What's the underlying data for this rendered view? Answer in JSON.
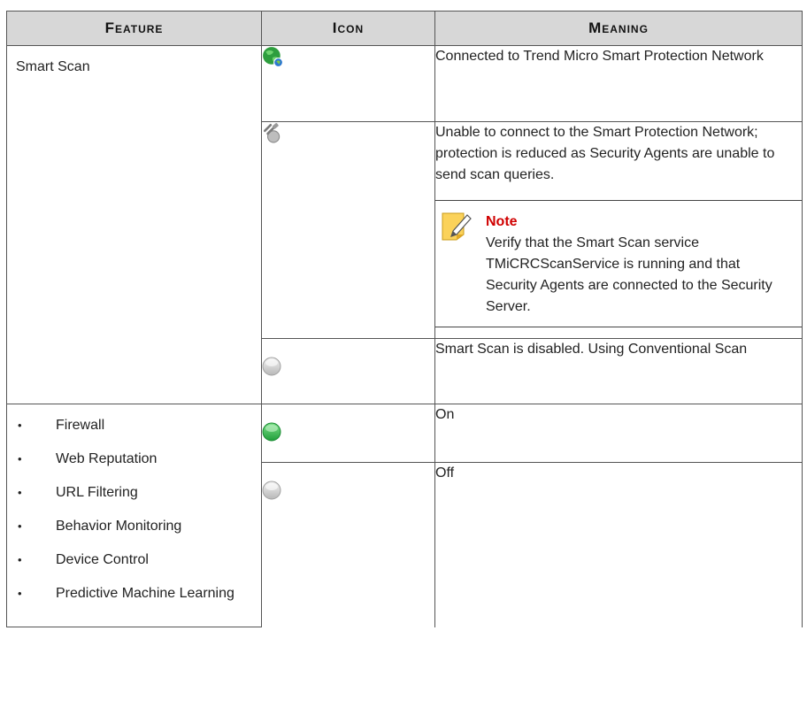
{
  "headers": {
    "feature": "Feature",
    "icon": "Icon",
    "meaning": "Meaning"
  },
  "smart_scan": {
    "feature": "Smart Scan",
    "rows": [
      {
        "icon": "globe-connected-icon",
        "meaning": "Connected to Trend Micro Smart Protection Network"
      },
      {
        "icon": "disconnected-plug-icon",
        "meaning": "Unable to connect to the Smart Protection Network; protection is reduced as Security Agents are unable to send scan queries."
      },
      {
        "icon": "gray-circle-icon",
        "meaning": "Smart Scan is disabled. Using Conventional Scan"
      }
    ],
    "note": {
      "icon": "note-pencil-icon",
      "title": "Note",
      "body": "Verify that the Smart Scan service TMiCRCScanService is running and that Security Agents are connected to the Security Server."
    }
  },
  "protection": {
    "features": [
      "Firewall",
      "Web Reputation",
      "URL Filtering",
      "Behavior Monitoring",
      "Device Control",
      "Predictive Machine Learning"
    ],
    "rows": [
      {
        "icon": "green-circle-icon",
        "meaning": "On"
      },
      {
        "icon": "gray-circle-icon",
        "meaning": "Off"
      }
    ]
  },
  "colors": {
    "header_bg": "#d7d7d7",
    "note_title": "#d00000",
    "on_green": "#22b14c",
    "off_gray": "#c8c8c8"
  }
}
